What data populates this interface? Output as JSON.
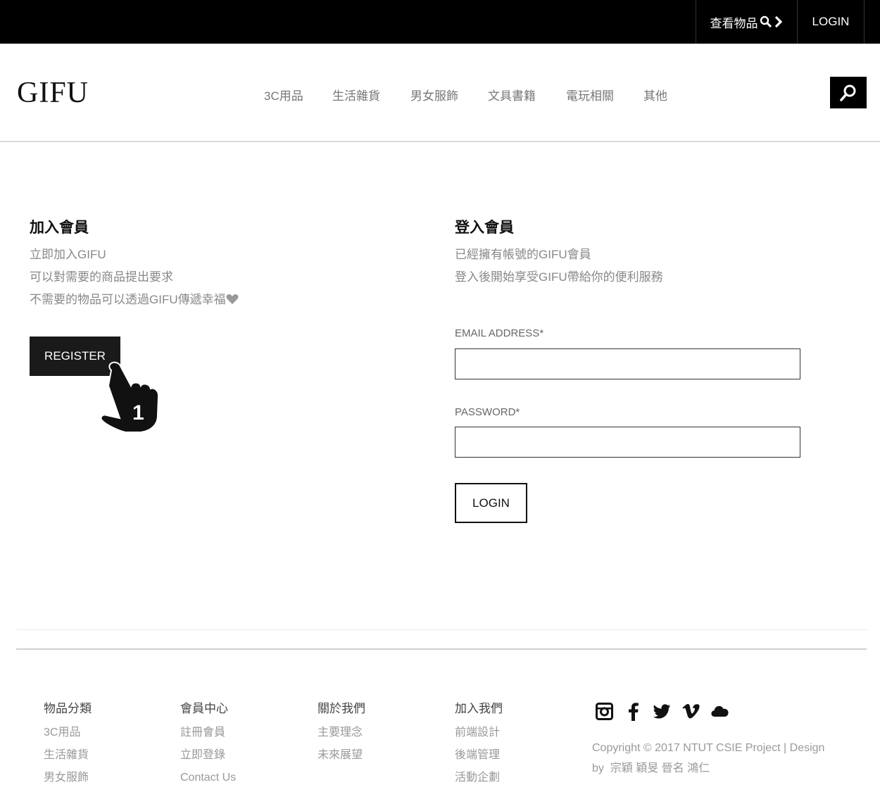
{
  "topbar": {
    "view_items": "查看物品",
    "login": "LOGIN"
  },
  "header": {
    "logo": "GIFU",
    "nav": [
      "3C用品",
      "生活雜貨",
      "男女服飾",
      "文具書籍",
      "電玩相關",
      "其他"
    ]
  },
  "register_section": {
    "title": "加入會員",
    "lines": [
      "立即加入GIFU",
      "可以對需要的商品提出要求",
      "不需要的物品可以透過GIFU傳遞幸福"
    ],
    "button": "REGISTER",
    "step_number": "1"
  },
  "login_section": {
    "title": "登入會員",
    "lines": [
      "已經擁有帳號的GIFU會員",
      "登入後開始享受GIFU帶給你的便利服務"
    ],
    "email_label": "EMAIL ADDRESS*",
    "email_value": "",
    "password_label": "PASSWORD*",
    "password_value": "",
    "button": "LOGIN"
  },
  "footer": {
    "columns": [
      {
        "title": "物品分類",
        "links": [
          "3C用品",
          "生活雜貨",
          "男女服飾"
        ]
      },
      {
        "title": "會員中心",
        "links": [
          "註冊會員",
          "立即登錄",
          "Contact Us"
        ]
      },
      {
        "title": "關於我們",
        "links": [
          "主要理念",
          "未來展望"
        ]
      },
      {
        "title": "加入我們",
        "links": [
          "前端設計",
          "後端管理",
          "活動企劃"
        ]
      }
    ],
    "social_icons": [
      "instagram-icon",
      "facebook-icon",
      "twitter-icon",
      "vimeo-icon",
      "cloud-icon"
    ],
    "copyright_line1": "Copyright © 2017 NTUT CSIE Project | Design",
    "copyright_line2": "by  宗穎 穎旻 晉名 鴻仁"
  },
  "colors": {
    "topbar_bg": "#000000",
    "button_dark": "#1a1a1a",
    "text_muted": "#888888"
  }
}
